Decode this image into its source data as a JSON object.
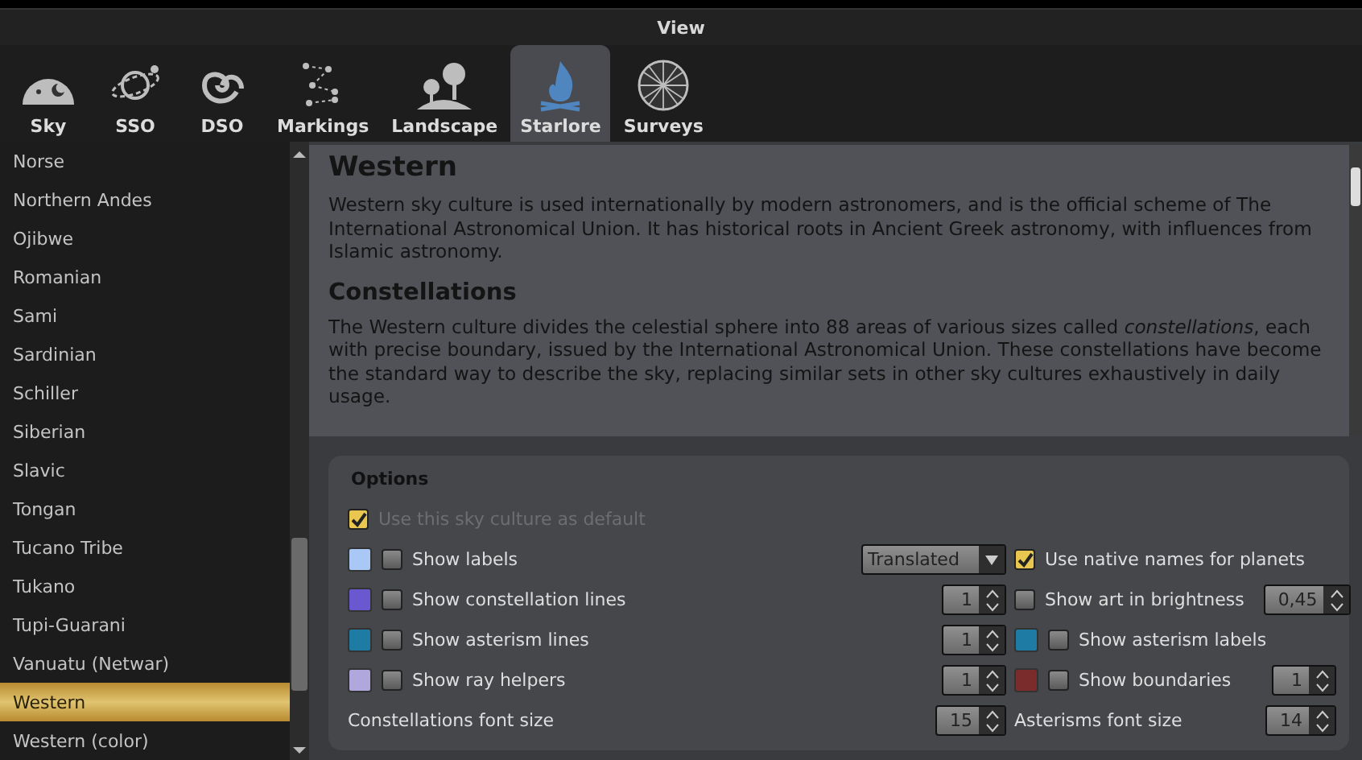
{
  "window": {
    "title": "View"
  },
  "tabs": [
    {
      "label": "Sky",
      "selected": false,
      "kind": "sky"
    },
    {
      "label": "SSO",
      "selected": false,
      "kind": "sso"
    },
    {
      "label": "DSO",
      "selected": false,
      "kind": "dso"
    },
    {
      "label": "Markings",
      "selected": false,
      "kind": "markings"
    },
    {
      "label": "Landscape",
      "selected": false,
      "kind": "landscape"
    },
    {
      "label": "Starlore",
      "selected": true,
      "kind": "starlore"
    },
    {
      "label": "Surveys",
      "selected": false,
      "kind": "surveys"
    }
  ],
  "cultures": [
    {
      "name": "Norse",
      "selected": false
    },
    {
      "name": "Northern Andes",
      "selected": false
    },
    {
      "name": "Ojibwe",
      "selected": false
    },
    {
      "name": "Romanian",
      "selected": false
    },
    {
      "name": "Sami",
      "selected": false
    },
    {
      "name": "Sardinian",
      "selected": false
    },
    {
      "name": "Schiller",
      "selected": false
    },
    {
      "name": "Siberian",
      "selected": false
    },
    {
      "name": "Slavic",
      "selected": false
    },
    {
      "name": "Tongan",
      "selected": false
    },
    {
      "name": "Tucano Tribe",
      "selected": false
    },
    {
      "name": "Tukano",
      "selected": false
    },
    {
      "name": "Tupi-Guarani",
      "selected": false
    },
    {
      "name": "Vanuatu (Netwar)",
      "selected": false
    },
    {
      "name": "Western",
      "selected": true
    },
    {
      "name": "Western (color)",
      "selected": false
    }
  ],
  "description": {
    "title": "Western",
    "intro": "Western sky culture is used internationally by modern astronomers, and is the official scheme of The International Astronomical Union. It has historical roots in Ancient Greek astronomy, with influences from Islamic astronomy.",
    "section_title": "Constellations",
    "section_text": "The Western culture divides the celestial sphere into 88 areas of various sizes called *constellations*, each with precise boundary, issued by the International Astronomical Union. These constellations have become the standard way to describe the sky, replacing similar sets in other sky cultures exhaustively in daily usage."
  },
  "options": {
    "title": "Options",
    "default": {
      "label": "Use this sky culture as default",
      "checked": true
    },
    "rows": [
      {
        "left": {
          "color": "#a9c8f5",
          "checked": false,
          "label": "Show labels"
        },
        "control": {
          "kind": "select",
          "value": "Translated"
        },
        "right": {
          "checked": true,
          "label": "Use native names for planets"
        }
      },
      {
        "left": {
          "color": "#6a58d0",
          "checked": false,
          "label": "Show constellation lines"
        },
        "control": {
          "kind": "spin",
          "value": "1"
        },
        "right": {
          "checked": false,
          "label": "Show art in brightness",
          "spin": "0,45"
        }
      },
      {
        "left": {
          "color": "#1e7ca4",
          "checked": false,
          "label": "Show asterism lines"
        },
        "control": {
          "kind": "spin",
          "value": "1"
        },
        "right": {
          "color": "#1e7ca4",
          "checked": false,
          "label": "Show asterism labels"
        }
      },
      {
        "left": {
          "color": "#b0a8dc",
          "checked": false,
          "label": "Show ray helpers"
        },
        "control": {
          "kind": "spin",
          "value": "1"
        },
        "right": {
          "color": "#7a2c2c",
          "checked": false,
          "label": "Show boundaries",
          "spin": "1"
        }
      },
      {
        "left": {
          "label": "Constellations font size"
        },
        "control": {
          "kind": "spin",
          "value": "15"
        },
        "right": {
          "label": "Asterisms font size",
          "spin": "14"
        }
      }
    ]
  }
}
